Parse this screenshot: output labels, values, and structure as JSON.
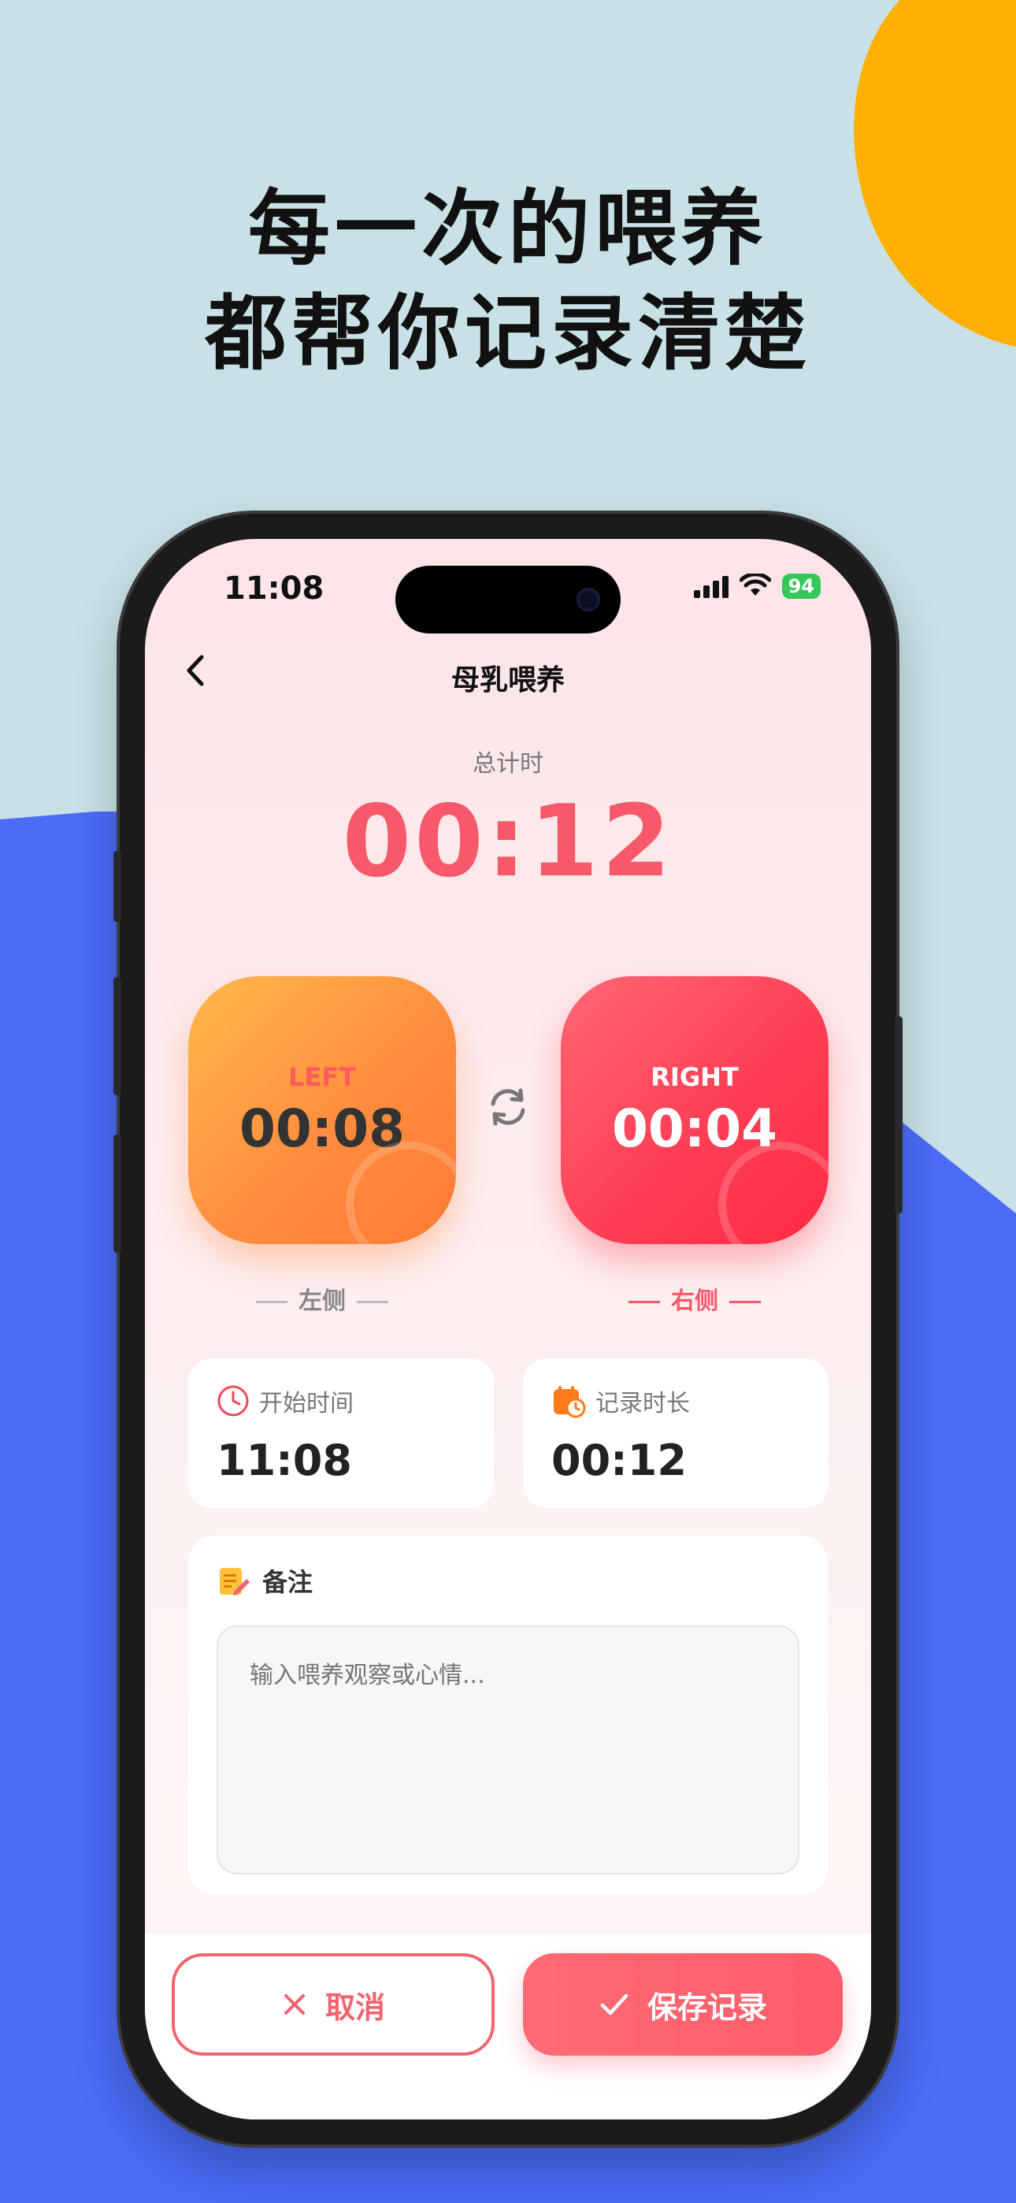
{
  "promo": {
    "line1": "每一次的喂养",
    "line2": "都帮你记录清楚"
  },
  "status_bar": {
    "time": "11:08",
    "battery": "94"
  },
  "nav": {
    "title": "母乳喂养"
  },
  "total": {
    "label": "总计时",
    "time": "00:12"
  },
  "timers": {
    "left": {
      "side": "LEFT",
      "time": "00:08",
      "caption": "左侧"
    },
    "right": {
      "side": "RIGHT",
      "time": "00:04",
      "caption": "右侧"
    }
  },
  "info": {
    "start_label": "开始时间",
    "start_value": "11:08",
    "duration_label": "记录时长",
    "duration_value": "00:12"
  },
  "note": {
    "label": "备注",
    "placeholder": "输入喂养观察或心情..."
  },
  "actions": {
    "cancel_label": "取消",
    "save_label": "保存记录"
  },
  "colors": {
    "accent": "#f7596a",
    "left_timer": "#ff8a3d",
    "right_timer": "#ff3f55",
    "background_teal": "#c8e1e6",
    "background_blue": "#4a6cf7",
    "background_orange": "#ffb000"
  }
}
